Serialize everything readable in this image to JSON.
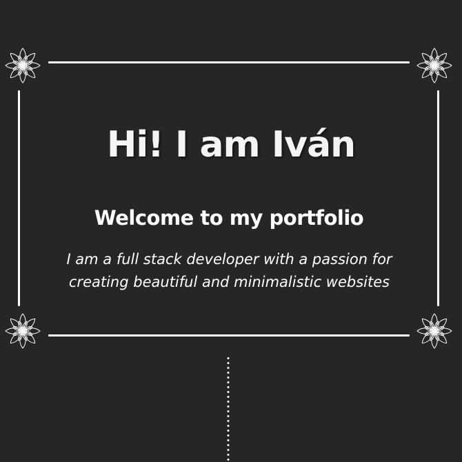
{
  "hero": {
    "title": "Hi! I am Iván",
    "subtitle": "Welcome to my portfolio",
    "description": "I am a full stack developer with a passion for creating beautiful and minimalistic websites"
  },
  "decorations": {
    "corner_icon": "flower-icon",
    "frame_color": "#ffffff",
    "background_color": "#262626"
  }
}
